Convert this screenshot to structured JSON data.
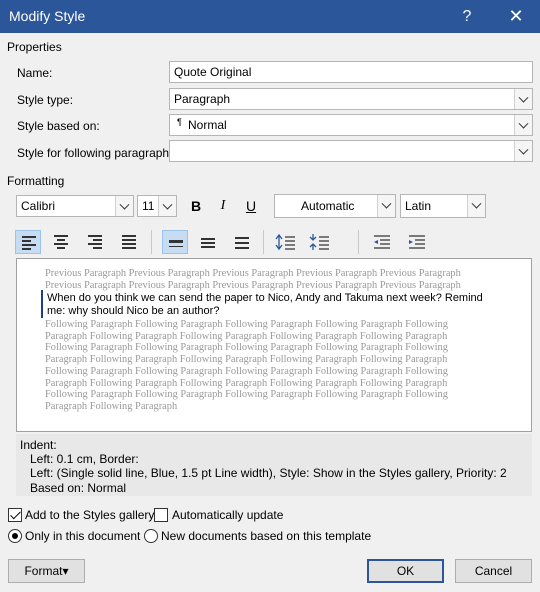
{
  "window": {
    "title": "Modify Style",
    "help_glyph": "?",
    "close_glyph": "✕"
  },
  "properties": {
    "section_label": "Properties",
    "name_label": "Name:",
    "name_value": "Quote Original",
    "style_type_label": "Style type:",
    "style_type_value": "Paragraph",
    "based_on_label": "Style based on:",
    "based_on_value": "Normal",
    "based_on_icon": "paragraph-mark",
    "following_label": "Style for following paragraph:",
    "following_value": ""
  },
  "formatting": {
    "section_label": "Formatting",
    "font": "Calibri",
    "size": "11",
    "bold": "B",
    "italic": "I",
    "underline": "U",
    "color": "Automatic",
    "script": "Latin"
  },
  "preview": {
    "previous": "Previous Paragraph Previous Paragraph Previous Paragraph Previous Paragraph Previous Paragraph Previous Paragraph Previous Paragraph Previous Paragraph Previous Paragraph Previous Paragraph",
    "main": "When do you think we can send the paper to Nico, Andy and Takuma next week? Remind me: why should Nico be an author?",
    "following": "Following Paragraph Following Paragraph Following Paragraph Following Paragraph Following Paragraph Following Paragraph Following Paragraph Following Paragraph Following Paragraph Following Paragraph Following Paragraph Following Paragraph Following Paragraph Following Paragraph Following Paragraph Following Paragraph Following Paragraph Following Paragraph Following Paragraph Following Paragraph Following Paragraph Following Paragraph Following Paragraph Following Paragraph Following Paragraph Following Paragraph Following Paragraph Following Paragraph Following Paragraph Following Paragraph Following Paragraph Following Paragraph Following Paragraph"
  },
  "description": {
    "line1": "Indent:",
    "line2": "Left:  0.1 cm, Border:",
    "line3": "Left: (Single solid line, Blue,  1.5 pt Line width), Style: Show in the Styles gallery, Priority: 2",
    "line4": "Based on: Normal"
  },
  "options": {
    "add_gallery": "Add to the Styles gallery",
    "add_gallery_checked": true,
    "auto_update": "Automatically update",
    "auto_update_checked": false,
    "only_doc": "Only in this document",
    "new_docs": "New documents based on this template"
  },
  "buttons": {
    "format": "Format",
    "format_arrow": "▾",
    "ok": "OK",
    "cancel": "Cancel"
  },
  "colors": {
    "titlebar": "#2b579a",
    "border_preview": "#1f3b8c",
    "active_button": "#c5dcf3"
  }
}
